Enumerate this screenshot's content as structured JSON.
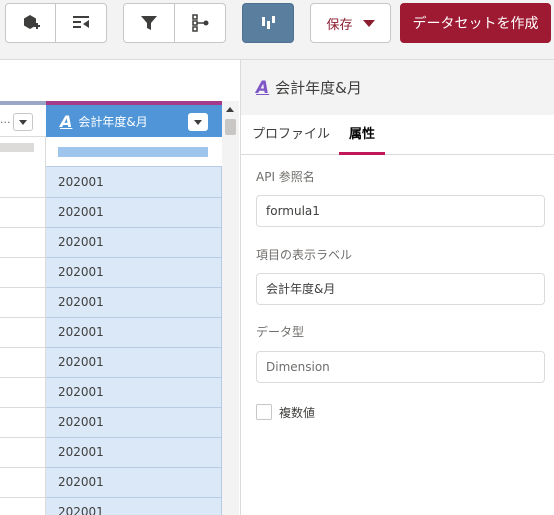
{
  "toolbar": {
    "save_label": "保存",
    "create_label": "データセットを作成",
    "icons": [
      "add-node-icon",
      "list-filter-icon",
      "funnel-icon",
      "tree-icon",
      "bar-chart-icon"
    ]
  },
  "grid": {
    "other_column": {
      "label": "..."
    },
    "selected_column": {
      "name": "会計年度&月",
      "type_icon": "formula-text-icon"
    },
    "rows": [
      "202001",
      "202001",
      "202001",
      "202001",
      "202001",
      "202001",
      "202001",
      "202001",
      "202001",
      "202001",
      "202001",
      "202001"
    ]
  },
  "panel": {
    "title": "会計年度&月",
    "tabs": [
      "プロファイル",
      "属性"
    ],
    "active_tab": "属性",
    "api_name_label": "API 参照名",
    "api_name_value": "formula1",
    "display_label_label": "項目の表示ラベル",
    "display_label_value": "会計年度&月",
    "data_type_label": "データ型",
    "data_type_value": "Dimension",
    "multi_value_label": "複数値"
  },
  "colors": {
    "primary_dark": "#9e1a32",
    "selected_header": "#4f95d8",
    "selected_cells": "#dbe8f8",
    "active_tab_underline": "#c2185b"
  }
}
